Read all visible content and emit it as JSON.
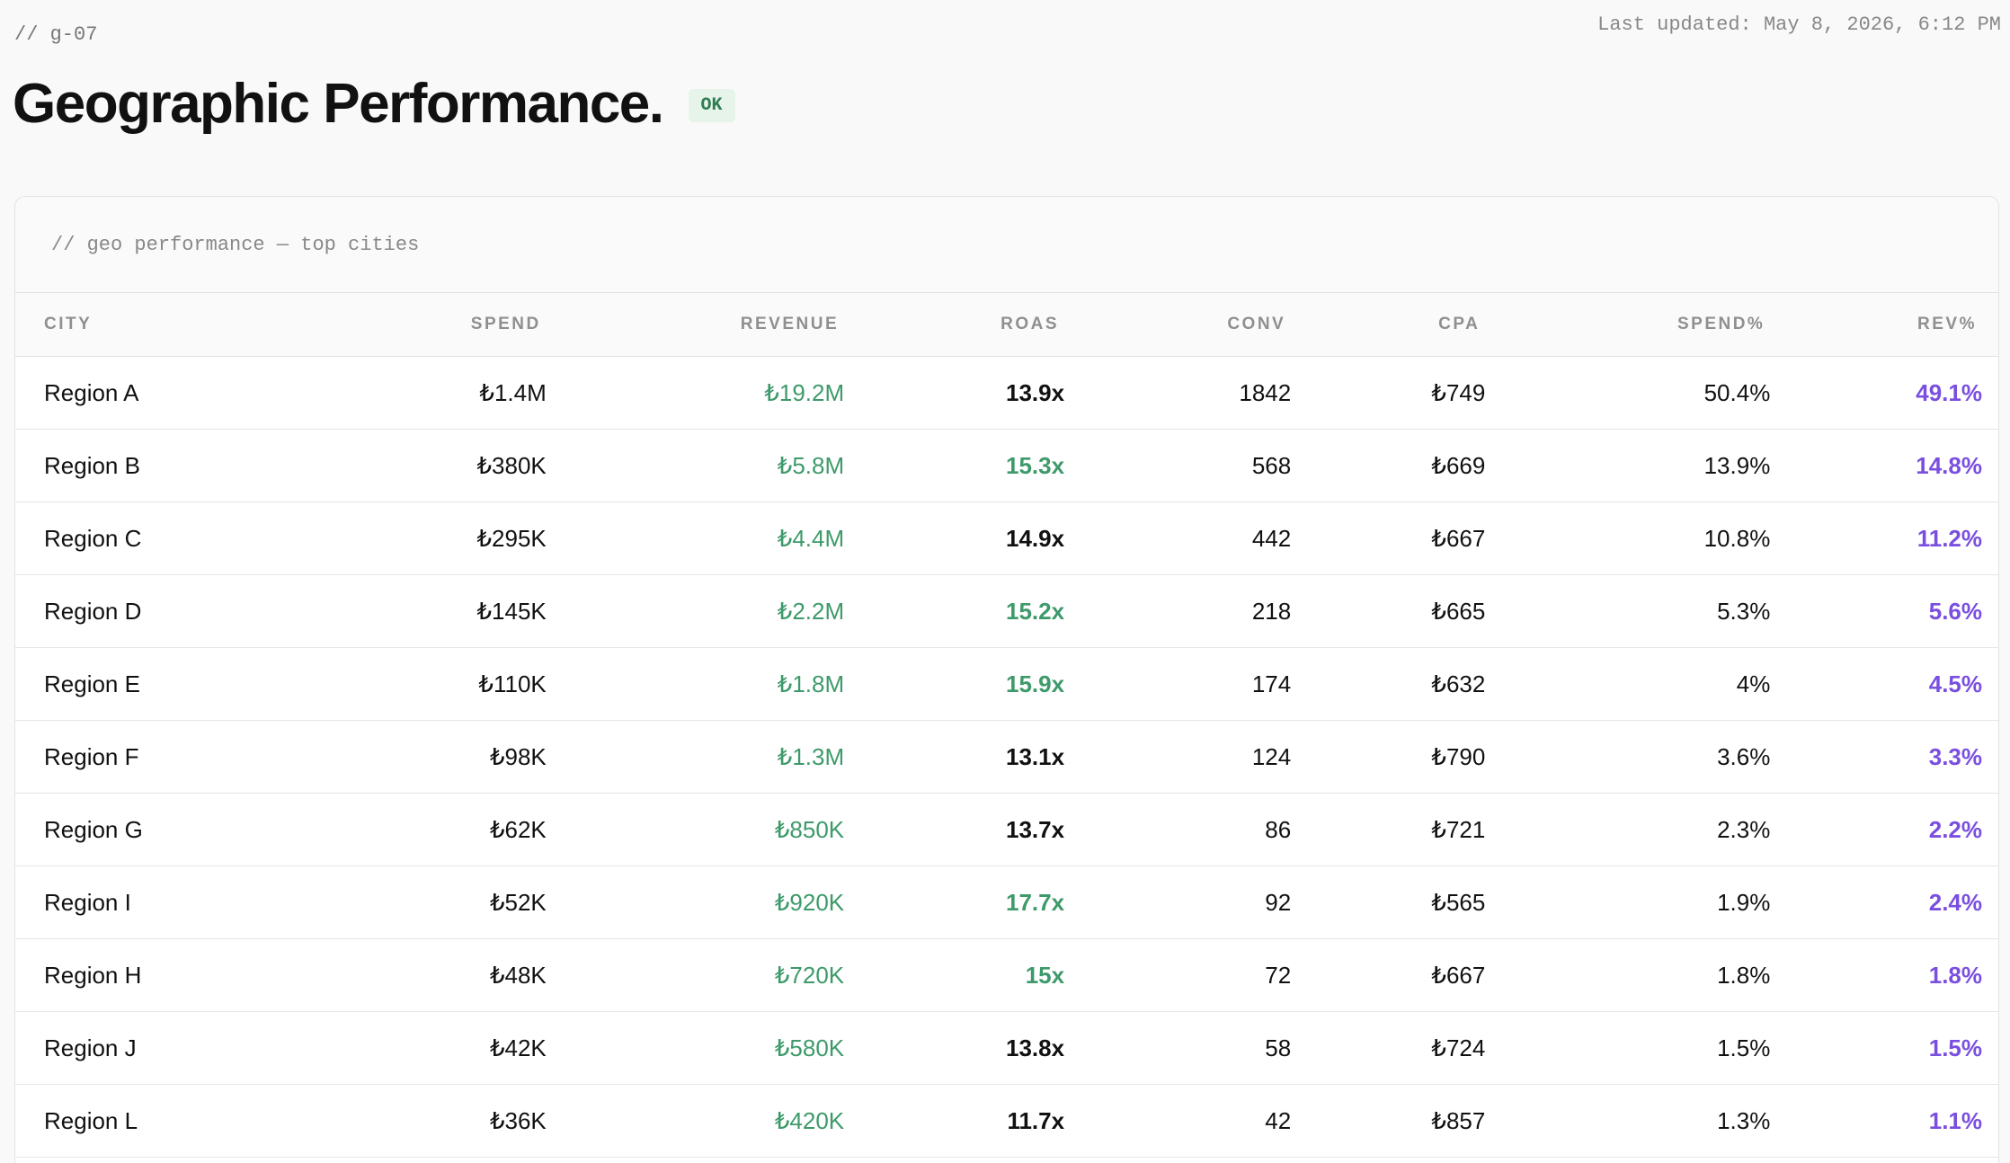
{
  "header": {
    "crumb": "// g-07",
    "title": "Geographic Performance.",
    "status_badge": "OK",
    "last_updated": "Last updated: May 8, 2026, 6:12 PM"
  },
  "card": {
    "caption": "// geo performance — top cities"
  },
  "table": {
    "columns": [
      "CITY",
      "SPEND",
      "REVENUE",
      "ROAS",
      "CONV",
      "CPA",
      "SPEND%",
      "REV%"
    ],
    "rows": [
      {
        "city": "Region A",
        "spend": "₺1.4M",
        "revenue": "₺19.2M",
        "roas": "13.9x",
        "roas_good": false,
        "conv": "1842",
        "cpa": "₺749",
        "spend_pct": "50.4%",
        "rev_pct": "49.1%"
      },
      {
        "city": "Region B",
        "spend": "₺380K",
        "revenue": "₺5.8M",
        "roas": "15.3x",
        "roas_good": true,
        "conv": "568",
        "cpa": "₺669",
        "spend_pct": "13.9%",
        "rev_pct": "14.8%"
      },
      {
        "city": "Region C",
        "spend": "₺295K",
        "revenue": "₺4.4M",
        "roas": "14.9x",
        "roas_good": false,
        "conv": "442",
        "cpa": "₺667",
        "spend_pct": "10.8%",
        "rev_pct": "11.2%"
      },
      {
        "city": "Region D",
        "spend": "₺145K",
        "revenue": "₺2.2M",
        "roas": "15.2x",
        "roas_good": true,
        "conv": "218",
        "cpa": "₺665",
        "spend_pct": "5.3%",
        "rev_pct": "5.6%"
      },
      {
        "city": "Region E",
        "spend": "₺110K",
        "revenue": "₺1.8M",
        "roas": "15.9x",
        "roas_good": true,
        "conv": "174",
        "cpa": "₺632",
        "spend_pct": "4%",
        "rev_pct": "4.5%"
      },
      {
        "city": "Region F",
        "spend": "₺98K",
        "revenue": "₺1.3M",
        "roas": "13.1x",
        "roas_good": false,
        "conv": "124",
        "cpa": "₺790",
        "spend_pct": "3.6%",
        "rev_pct": "3.3%"
      },
      {
        "city": "Region G",
        "spend": "₺62K",
        "revenue": "₺850K",
        "roas": "13.7x",
        "roas_good": false,
        "conv": "86",
        "cpa": "₺721",
        "spend_pct": "2.3%",
        "rev_pct": "2.2%"
      },
      {
        "city": "Region I",
        "spend": "₺52K",
        "revenue": "₺920K",
        "roas": "17.7x",
        "roas_good": true,
        "conv": "92",
        "cpa": "₺565",
        "spend_pct": "1.9%",
        "rev_pct": "2.4%"
      },
      {
        "city": "Region H",
        "spend": "₺48K",
        "revenue": "₺720K",
        "roas": "15x",
        "roas_good": true,
        "conv": "72",
        "cpa": "₺667",
        "spend_pct": "1.8%",
        "rev_pct": "1.8%"
      },
      {
        "city": "Region J",
        "spend": "₺42K",
        "revenue": "₺580K",
        "roas": "13.8x",
        "roas_good": false,
        "conv": "58",
        "cpa": "₺724",
        "spend_pct": "1.5%",
        "rev_pct": "1.5%"
      },
      {
        "city": "Region L",
        "spend": "₺36K",
        "revenue": "₺420K",
        "roas": "11.7x",
        "roas_good": false,
        "conv": "42",
        "cpa": "₺857",
        "spend_pct": "1.3%",
        "rev_pct": "1.1%"
      }
    ]
  },
  "colors": {
    "positive": "#3e9a6a",
    "accent_purple": "#7a4fe0",
    "badge_bg": "#e6f4ea"
  }
}
